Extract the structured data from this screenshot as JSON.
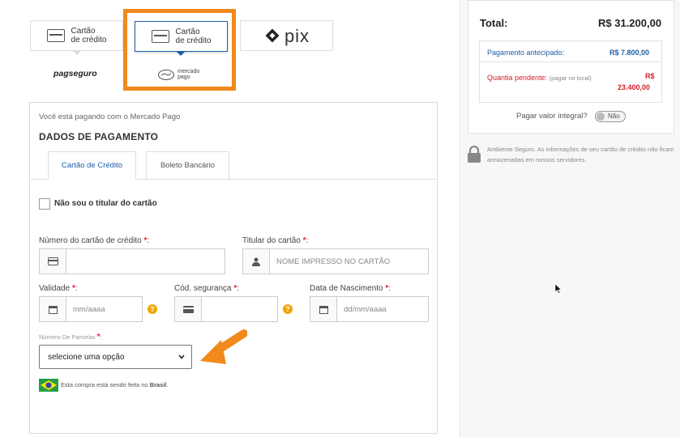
{
  "payment_methods": {
    "credit_card_1": "Cartão\nde crédito",
    "credit_card_2": "Cartão\nde crédito",
    "pix": "pix",
    "pagseguro_logo_text": "pagseguro",
    "mercadopago_logo_text": "mercado\npago"
  },
  "form": {
    "info": "Você está pagando com o Mercado Pago",
    "title": "DADOS DE PAGAMENTO",
    "tabs": [
      "Cartão de Crédito",
      "Boleto Bancário"
    ],
    "not_holder_label": "Não sou o titular do cartão",
    "card_number_label": "Número do cartão de crédito",
    "holder_label": "Titular do cartão",
    "holder_placeholder": "NOME IMPRESSO NO CARTÃO",
    "expiry_label": "Validade",
    "expiry_placeholder": "mm/aaaa",
    "cvv_label": "Cód. segurança",
    "birth_label": "Data de Nascimento",
    "birth_placeholder": "dd/mm/aaaa",
    "installments_label": "Número De Parcelas",
    "installments_selected": "selecione uma opção",
    "country_note_prefix": "Esta compra está sendo feita no ",
    "country_name": "Brasil",
    "required_marker": "*",
    "colon": ":"
  },
  "summary": {
    "total_label": "Total:",
    "total_value": "R$ 31.200,00",
    "advance_label": "Pagamento antecipado:",
    "advance_value": "R$ 7.800,00",
    "pending_label": "Quantia pendente:",
    "pending_note": "(pagar no local)",
    "pending_currency": "R$",
    "pending_value": "23.400,00",
    "pay_full_label": "Pagar valor integral?",
    "toggle_text": "Não",
    "secure_text": "Ambiente Seguro. As informações de seu cartão de crédito não ficam armazenadas em nossos servidores."
  },
  "colors": {
    "accent_orange": "#f08a1c",
    "link_blue": "#1d5fa8",
    "danger_red": "#d01f2a",
    "brazil_green": "#229e45"
  }
}
